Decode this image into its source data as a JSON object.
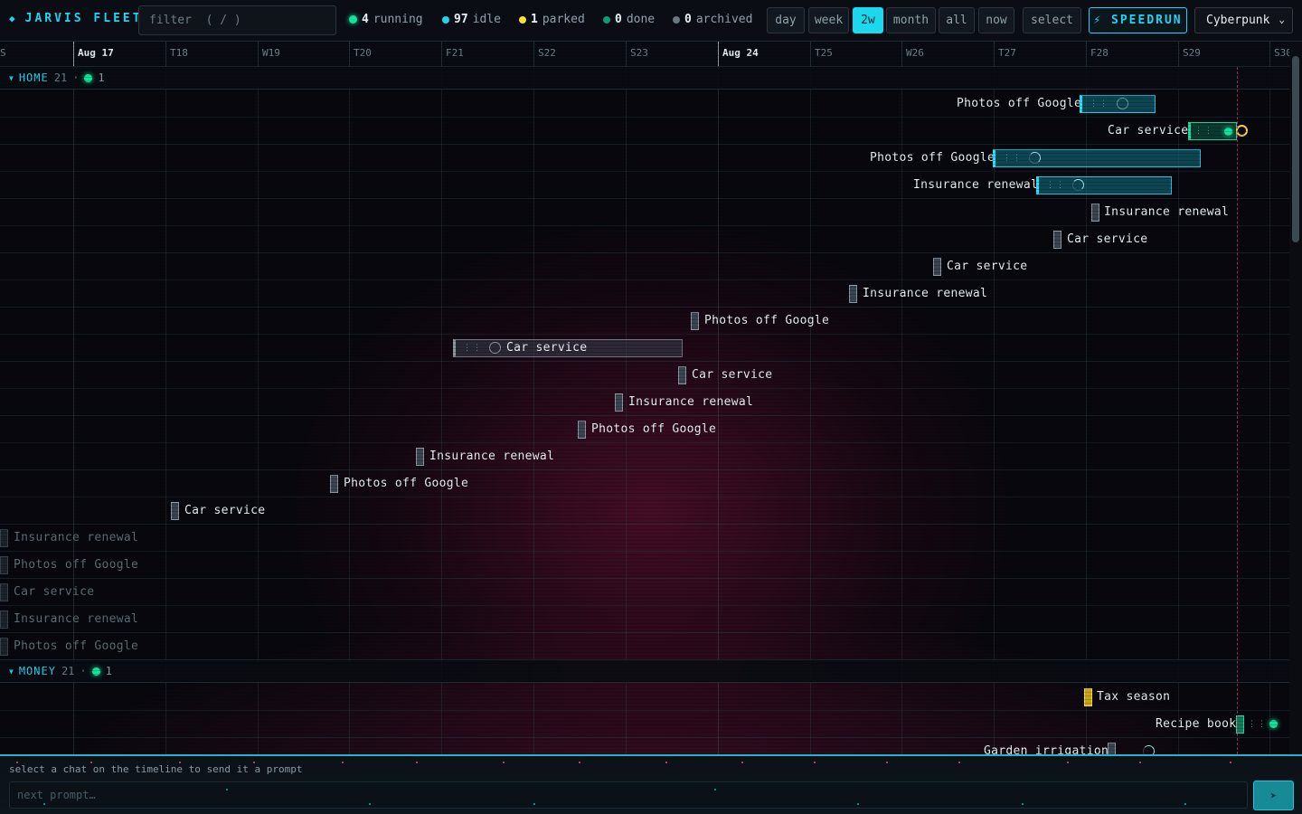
{
  "app": {
    "title": "JARVIS FLEET",
    "brand_icon": "diamond-icon"
  },
  "filter": {
    "placeholder": "filter  ( / )",
    "value": ""
  },
  "stats": [
    {
      "count": "4",
      "label": "running",
      "color": "#10e39a"
    },
    {
      "count": "97",
      "label": "idle",
      "color": "#22d3ee"
    },
    {
      "count": "1",
      "label": "parked",
      "color": "#f5e13a"
    },
    {
      "count": "0",
      "label": "done",
      "color": "#0f9c71"
    },
    {
      "count": "0",
      "label": "archived",
      "color": "#6a7780"
    }
  ],
  "range_buttons": [
    {
      "label": "day",
      "active": false
    },
    {
      "label": "week",
      "active": false
    },
    {
      "label": "2w",
      "active": true
    },
    {
      "label": "month",
      "active": false
    },
    {
      "label": "all",
      "active": false
    },
    {
      "label": "now",
      "active": false
    }
  ],
  "select_label": "select",
  "speedrun_label": "⚡ SPEEDRUN",
  "theme": {
    "selected": "Cyberpunk"
  },
  "axis_ticks": [
    "S",
    "Aug 17",
    "T18",
    "W19",
    "T20",
    "F21",
    "S22",
    "S23",
    "Aug 24",
    "T25",
    "W26",
    "T27",
    "F28",
    "S29",
    "S30"
  ],
  "groups": [
    {
      "name": "HOME",
      "count": "21",
      "running": "1",
      "rows": [
        "Photos off Google",
        "Car service",
        "Photos off Google",
        "Insurance renewal",
        "Insurance renewal",
        "Car service",
        "Car service",
        "Insurance renewal",
        "Photos off Google",
        "Car service",
        "Car service",
        "Insurance renewal",
        "Photos off Google",
        "Insurance renewal",
        "Photos off Google",
        "Car service",
        "Insurance renewal",
        "Photos off Google",
        "Car service",
        "Insurance renewal",
        "Photos off Google"
      ]
    },
    {
      "name": "MONEY",
      "count": "21",
      "running": "1",
      "rows": [
        "Tax season",
        "Recipe book",
        "Garden irrigation"
      ]
    }
  ],
  "prompt": {
    "hint": "select a chat on the timeline to send it a prompt",
    "placeholder": "next prompt…",
    "send_icon": "send-arrow-icon"
  },
  "colors": {
    "accent": "#22d3ee",
    "running": "#10e39a",
    "parked": "#f5e13a",
    "now_line": "#c0306a"
  }
}
